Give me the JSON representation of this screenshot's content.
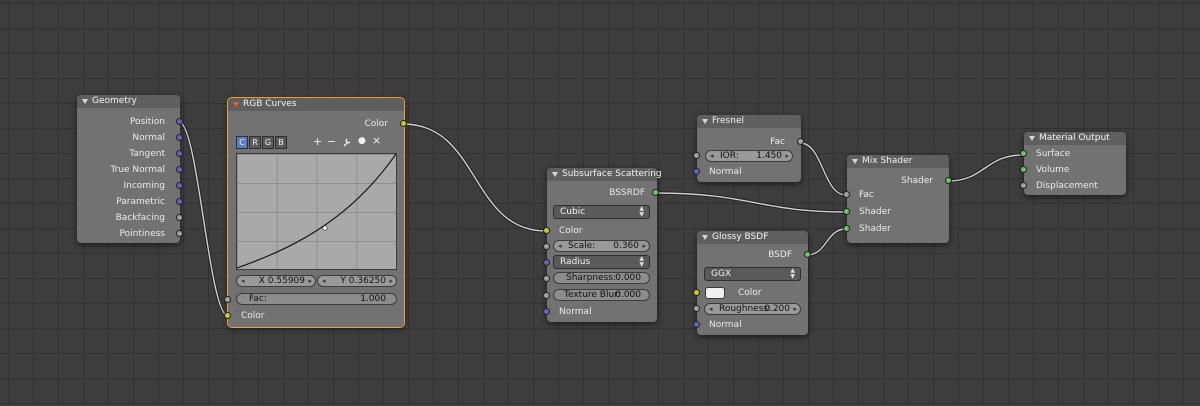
{
  "nodes": {
    "geometry": {
      "title": "Geometry",
      "outputs": [
        "Position",
        "Normal",
        "Tangent",
        "True Normal",
        "Incoming",
        "Parametric",
        "Backfacing",
        "Pointiness"
      ]
    },
    "rgb_curves": {
      "title": "RGB Curves",
      "output": "Color",
      "channels": [
        "C",
        "R",
        "G",
        "B"
      ],
      "active_channel": "C",
      "tools": [
        "+",
        "−",
        "wrench",
        "●",
        "×"
      ],
      "x_field": "X 0.55909",
      "y_field": "Y 0.36250",
      "fac_label": "Fac:",
      "fac_value": "1.000",
      "input_color": "Color"
    },
    "subsurface": {
      "title": "Subsurface Scattering",
      "output": "BSSRDF",
      "falloff": "Cubic",
      "color_label": "Color",
      "scale_label": "Scale:",
      "scale_value": "0.360",
      "radius": "Radius",
      "sharpness_label": "Sharpness:",
      "sharpness_value": "0.000",
      "texture_blur_label": "Texture Blur:",
      "texture_blur_value": "0.000",
      "normal": "Normal"
    },
    "fresnel": {
      "title": "Fresnel",
      "output": "Fac",
      "ior_label": "IOR:",
      "ior_value": "1.450",
      "normal": "Normal"
    },
    "glossy": {
      "title": "Glossy BSDF",
      "output": "BSDF",
      "distribution": "GGX",
      "color_label": "Color",
      "color_value": "#f0f0f0",
      "roughness_label": "Roughness:",
      "roughness_value": "0.200",
      "normal": "Normal"
    },
    "mix_shader": {
      "title": "Mix Shader",
      "output": "Shader",
      "inputs": [
        "Fac",
        "Shader",
        "Shader"
      ]
    },
    "material_output": {
      "title": "Material Output",
      "inputs": [
        "Surface",
        "Volume",
        "Displacement"
      ]
    }
  },
  "colors": {
    "background": "#3d3d3d",
    "node_body": "#727272",
    "node_header": "#5f5f5f",
    "selected_outline": "#f0a030",
    "socket_shader": "#63c763",
    "socket_vector": "#6363c7",
    "socket_float": "#a1a1a1",
    "socket_color": "#c7c729",
    "link": "#d0d0d0"
  }
}
